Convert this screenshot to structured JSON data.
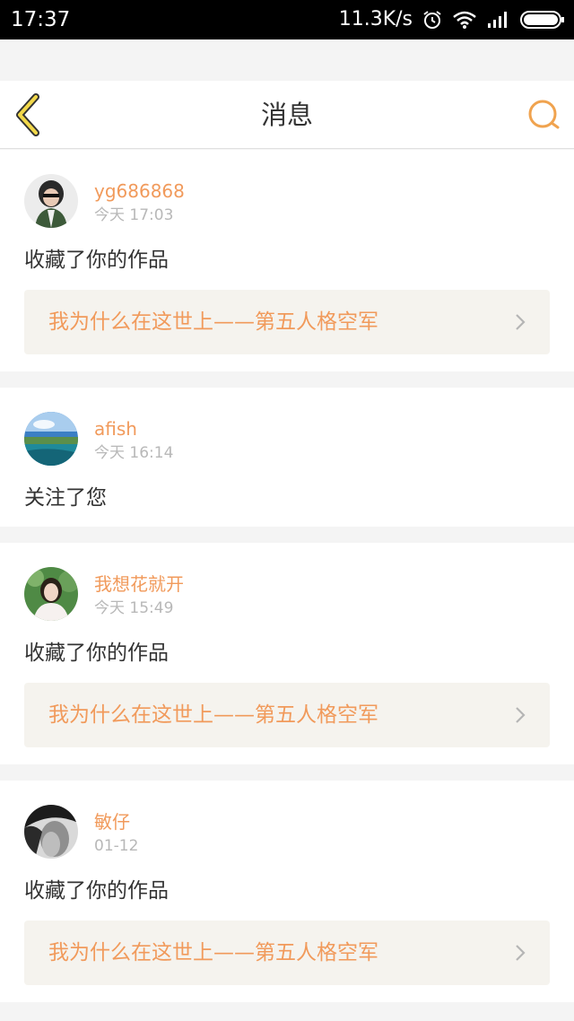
{
  "status_bar": {
    "time": "17:37",
    "speed": "11.3K/s",
    "icons": [
      "alarm-icon",
      "wifi-icon",
      "signal-icon",
      "battery-icon"
    ]
  },
  "header": {
    "title": "消息",
    "back_icon": "chevron-left-icon",
    "search_icon": "search-icon",
    "accent_color": "#f0a34f"
  },
  "colors": {
    "username": "#f19a5b",
    "timestamp": "#b8b8b8",
    "work_link_bg": "#f5f3ee",
    "page_bg": "#f4f4f4"
  },
  "messages": [
    {
      "username": "yg686868",
      "time": "今天 17:03",
      "action": "收藏了你的作品",
      "work_title": "我为什么在这世上——第五人格空军"
    },
    {
      "username": "afish",
      "time": "今天 16:14",
      "action": "关注了您"
    },
    {
      "username": "我想花就开",
      "time": "今天 15:49",
      "action": "收藏了你的作品",
      "work_title": "我为什么在这世上——第五人格空军"
    },
    {
      "username": "敏仔",
      "time": "01-12",
      "action": "收藏了你的作品",
      "work_title": "我为什么在这世上——第五人格空军"
    }
  ]
}
